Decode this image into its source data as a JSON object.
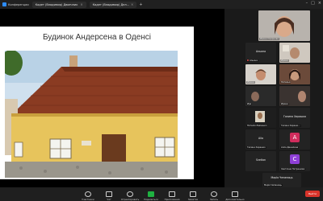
{
  "topbar": {
    "app_label": "Конференции",
    "tabs": [
      {
        "label": "Кадет (Владимир) Двоечник"
      },
      {
        "label": "Кадет (Владимир) Дел..."
      }
    ],
    "add_tab": "+"
  },
  "slide": {
    "title": "Будинок Андерсена в Оденсі"
  },
  "participants": [
    {
      "name": "Ирина Смирнова"
    },
    {
      "name": "Альона"
    },
    {
      "name": "Ирина"
    },
    {
      "name": "Ирина"
    },
    {
      "name": "Наталья"
    },
    {
      "name": "Светлана"
    },
    {
      "name": "Ира"
    },
    {
      "name": "Ирина"
    },
    {
      "name": "Наталія Левченко"
    },
    {
      "name": "Галина Харашко"
    },
    {
      "name": "Галина Харашк..."
    },
    {
      "name": "Галина Харашко"
    },
    {
      "name": "Alla"
    },
    {
      "name": "Алла Данилина"
    },
    {
      "name": "Svetlan"
    },
    {
      "name": "Светлана Петрашова"
    },
    {
      "name": "Марія Чепаниць"
    },
    {
      "name": "Марія Чепаниць"
    }
  ],
  "avatars": [
    {
      "letter": "A",
      "color": "#d02c5c"
    },
    {
      "letter": "C",
      "color": "#8e3fd6"
    }
  ],
  "toolbar": {
    "items": [
      {
        "label": "Участники"
      },
      {
        "label": "Чат"
      },
      {
        "label": "Отреагировать"
      },
      {
        "label": "Поделиться"
      },
      {
        "label": "Приложения"
      },
      {
        "label": "Заметки"
      },
      {
        "label": "Запись"
      },
      {
        "label": "Дополнительно"
      }
    ],
    "end_label": "Выйти"
  }
}
